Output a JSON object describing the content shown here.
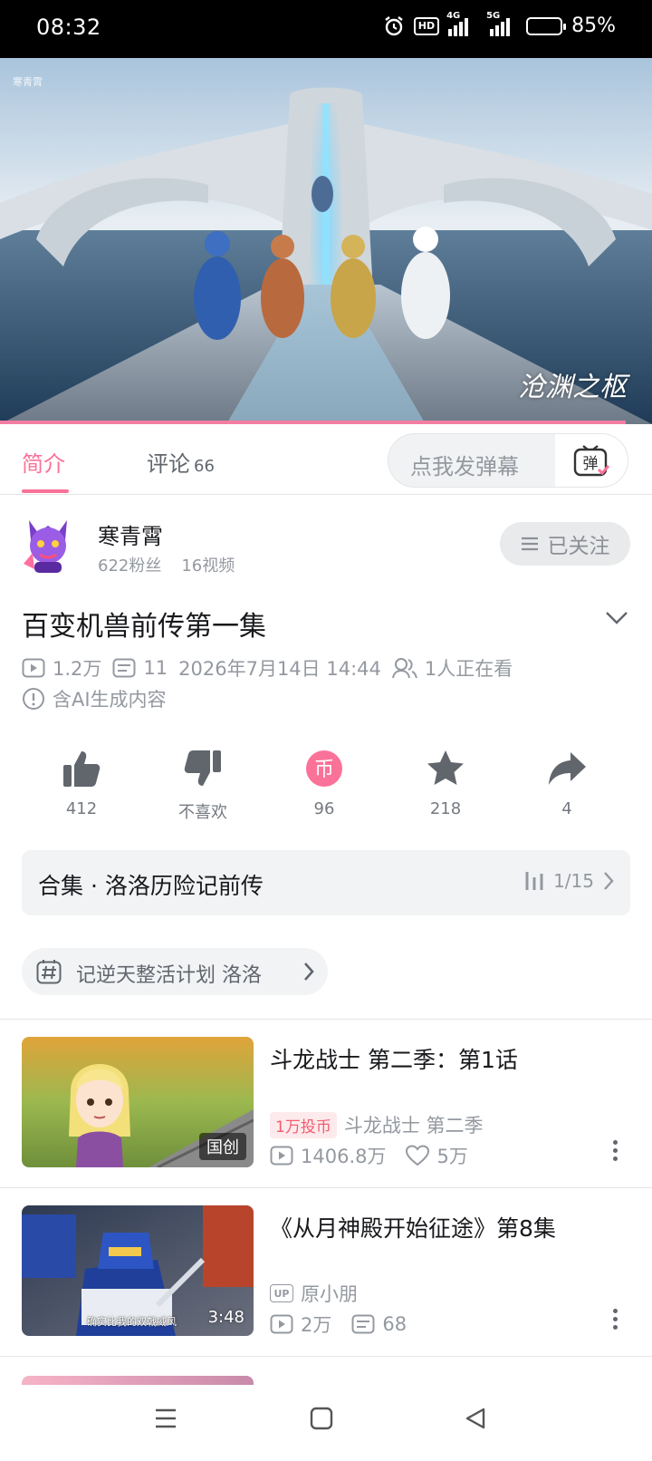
{
  "status_bar": {
    "time": "08:32",
    "battery": "85%",
    "hd": "HD",
    "net1": "4G",
    "net2": "5G",
    "battery_level": 0.85
  },
  "player": {
    "watermark": "寒青霄",
    "brand_mark": "沧渊之枢",
    "progress": 0.96
  },
  "tabs": {
    "intro": "简介",
    "comments": "评论",
    "comment_count": "66",
    "danmaku_placeholder": "点我发弹幕",
    "danmaku_button": "弹"
  },
  "uploader": {
    "name": "寒青霄",
    "fans": "622粉丝",
    "videos": "16视频",
    "follow_label": "已关注"
  },
  "video": {
    "title": "百变机兽前传第一集",
    "views": "1.2万",
    "danmaku": "11",
    "date": "2026年7月14日 14:44",
    "watching": "1人正在看",
    "ai_notice": "含AI生成内容"
  },
  "actions": {
    "like": "412",
    "dislike": "不喜欢",
    "coin": "96",
    "coin_glyph": "币",
    "favorite": "218",
    "share": "4"
  },
  "collection": {
    "title": "合集 · 洛洛历险记前传",
    "progress": "1/15"
  },
  "tag": {
    "text": "记逆天整活计划   洛洛"
  },
  "recommendations": [
    {
      "title": "斗龙战士 第二季：第1话",
      "coin_badge": "1万投币",
      "source": "斗龙战士 第二季",
      "views": "1406.8万",
      "likes": "5万",
      "thumb_badge": "国创"
    },
    {
      "title": "《从月神殿开始征途》第8集",
      "up_tag": "UP",
      "source": "原小朋",
      "views": "2万",
      "danmaku": "68",
      "duration": "3:48",
      "thumb_caption": "确实比我的双戟威风"
    }
  ]
}
